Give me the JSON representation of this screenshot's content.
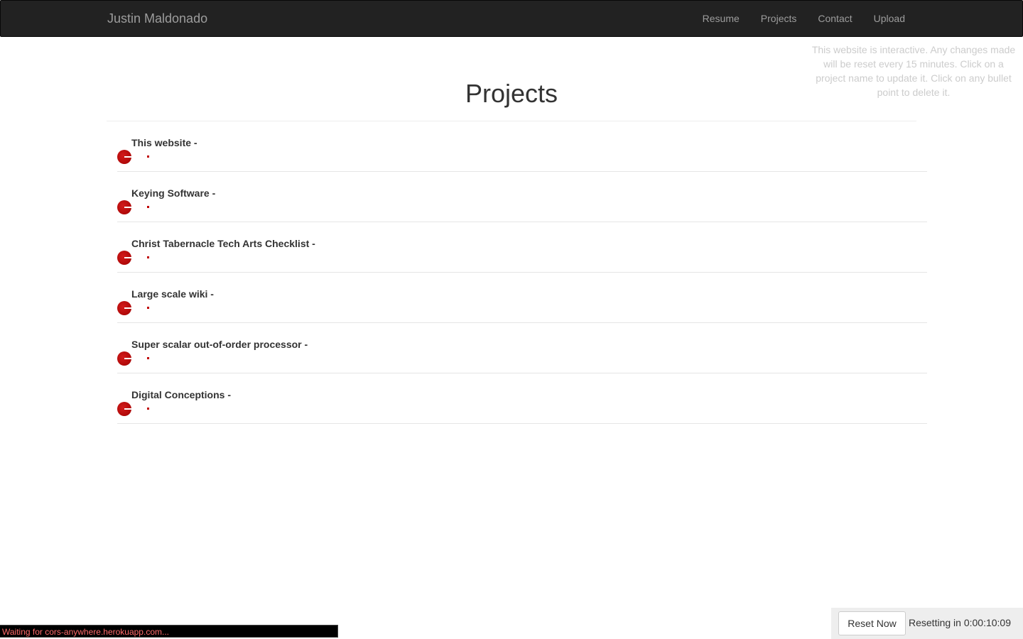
{
  "navbar": {
    "brand": "Justin Maldonado",
    "links": [
      {
        "label": "Resume"
      },
      {
        "label": "Projects"
      },
      {
        "label": "Contact"
      },
      {
        "label": "Upload"
      }
    ]
  },
  "notice": "This website is interactive. Any changes made will be reset every 15 minutes. Click on a project name to update it. Click on any bullet point to delete it.",
  "page": {
    "title": "Projects"
  },
  "projects": [
    {
      "name": "This website -"
    },
    {
      "name": "Keying Software -"
    },
    {
      "name": "Christ Tabernacle Tech Arts Checklist -"
    },
    {
      "name": "Large scale wiki -"
    },
    {
      "name": "Super scalar out-of-order processor -"
    },
    {
      "name": "Digital Conceptions -"
    }
  ],
  "status_bar": {
    "text": "Waiting for cors-anywhere.herokuapp.com..."
  },
  "reset": {
    "button_label": "Reset Now",
    "timer_label": "Resetting in",
    "timer_value": "0:00:10:09"
  },
  "colors": {
    "navbar_bg": "#222222",
    "delete_red": "#b50b0b",
    "notice_text": "#cccccc"
  }
}
